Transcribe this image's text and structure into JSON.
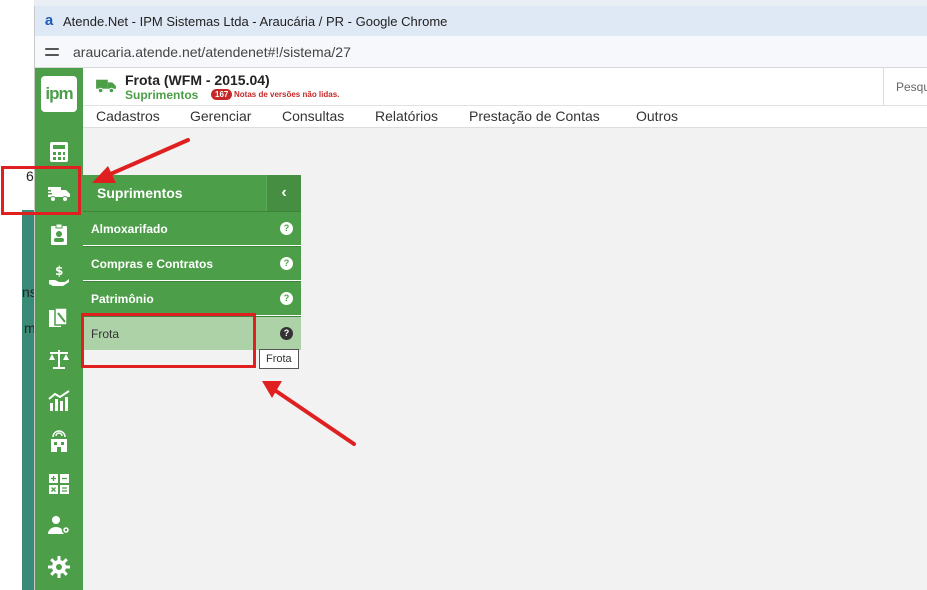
{
  "window": {
    "title": "Atende.Net - IPM Sistemas Ltda - Araucária / PR - Google Chrome",
    "url": "araucaria.atende.net/atendenet#!/sistema/27"
  },
  "background_fragments": [
    "6",
    "ns",
    "m"
  ],
  "app": {
    "logo": "ipm",
    "title": "Frota (WFM - 2015.04)",
    "module": "Suprimentos",
    "badge_count": "167",
    "notes_text": "Notas de versões não lidas.",
    "search_placeholder": "Pesqu"
  },
  "menu": [
    "Cadastros",
    "Gerenciar",
    "Consultas",
    "Relatórios",
    "Prestação de Contas",
    "Outros"
  ],
  "sidebar_icons": [
    "calculator-icon",
    "truck-icon",
    "badge-icon",
    "money-hand-icon",
    "documents-icon",
    "scale-icon",
    "chart-icon",
    "building-icon",
    "math-grid-icon",
    "user-settings-icon",
    "gear-icon"
  ],
  "flyout": {
    "title": "Suprimentos",
    "items": [
      {
        "label": "Almoxarifado"
      },
      {
        "label": "Compras e Contratos"
      },
      {
        "label": "Patrimônio"
      },
      {
        "label": "Frota"
      }
    ],
    "tooltip": "Frota"
  },
  "colors": {
    "brand_green": "#4c9e48",
    "active_item": "#aed2a8",
    "annotation_red": "#e02020",
    "badge_red": "#c62828"
  }
}
